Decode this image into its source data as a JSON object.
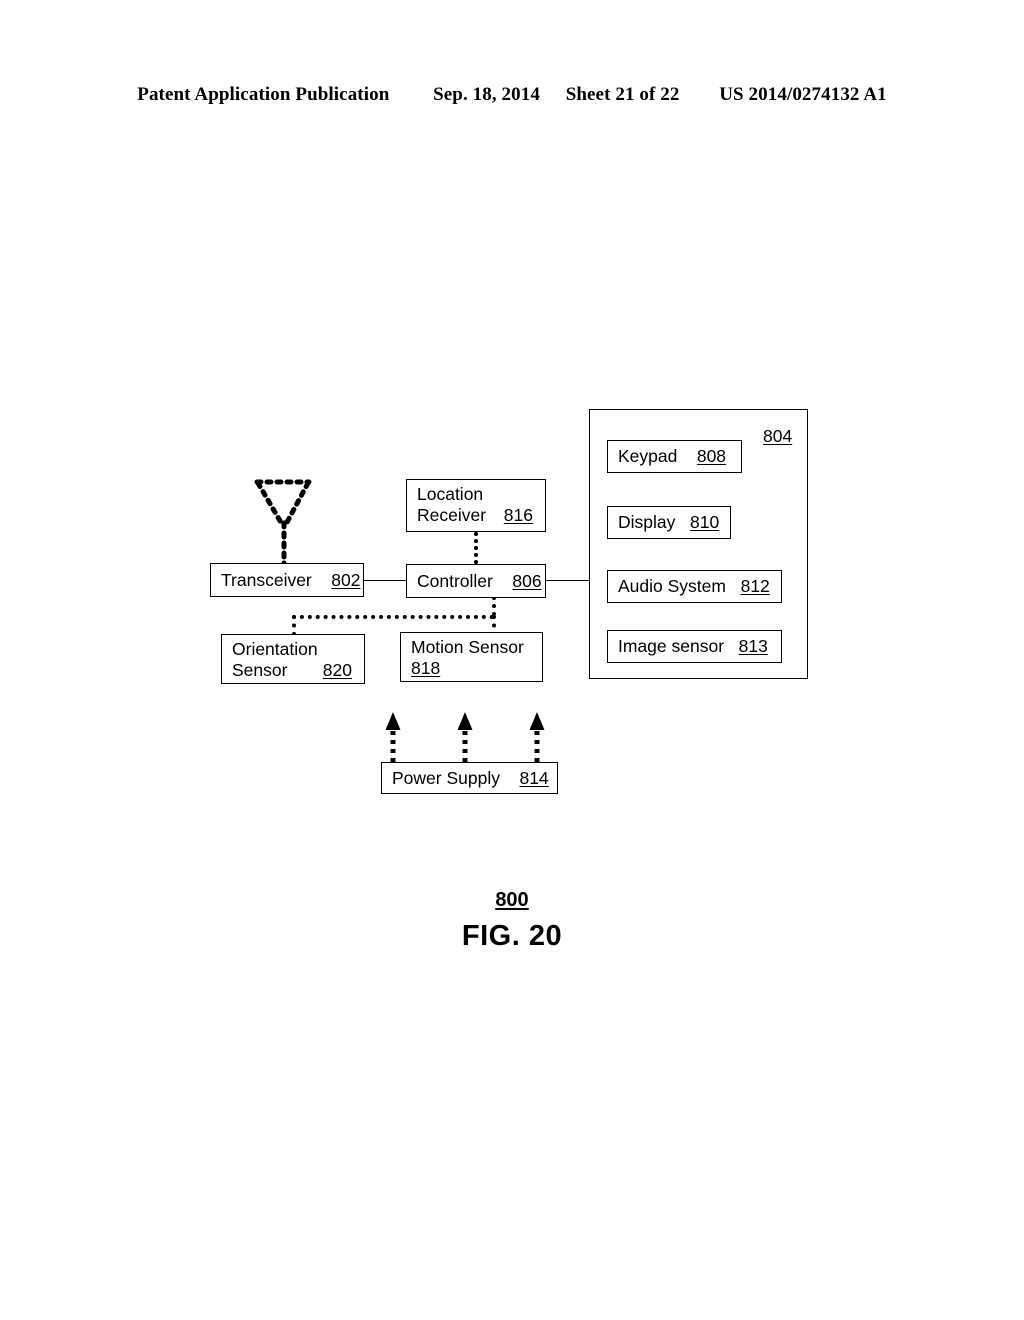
{
  "header": {
    "publication": "Patent Application Publication",
    "date": "Sep. 18, 2014",
    "sheet": "Sheet 21 of 22",
    "patent_number": "US 2014/0274132 A1"
  },
  "figure": {
    "number": "800",
    "caption": "FIG. 20"
  },
  "panel": {
    "reference": "804"
  },
  "nodes": {
    "transceiver": {
      "label": "Transceiver",
      "ref": "802"
    },
    "controller": {
      "label": "Controller",
      "ref": "806"
    },
    "location_receiver": {
      "line1": "Location",
      "line2": "Receiver",
      "ref": "816"
    },
    "orientation_sensor": {
      "line1": "Orientation",
      "line2": "Sensor",
      "ref": "820"
    },
    "motion_sensor": {
      "line1": "Motion Sensor",
      "ref": "818"
    },
    "power_supply": {
      "label": "Power Supply",
      "ref": "814"
    },
    "keypad": {
      "label": "Keypad",
      "ref": "808"
    },
    "display": {
      "label": "Display",
      "ref": "810"
    },
    "audio_system": {
      "label": "Audio System",
      "ref": "812"
    },
    "image_sensor": {
      "label": "Image sensor",
      "ref": "813"
    }
  }
}
